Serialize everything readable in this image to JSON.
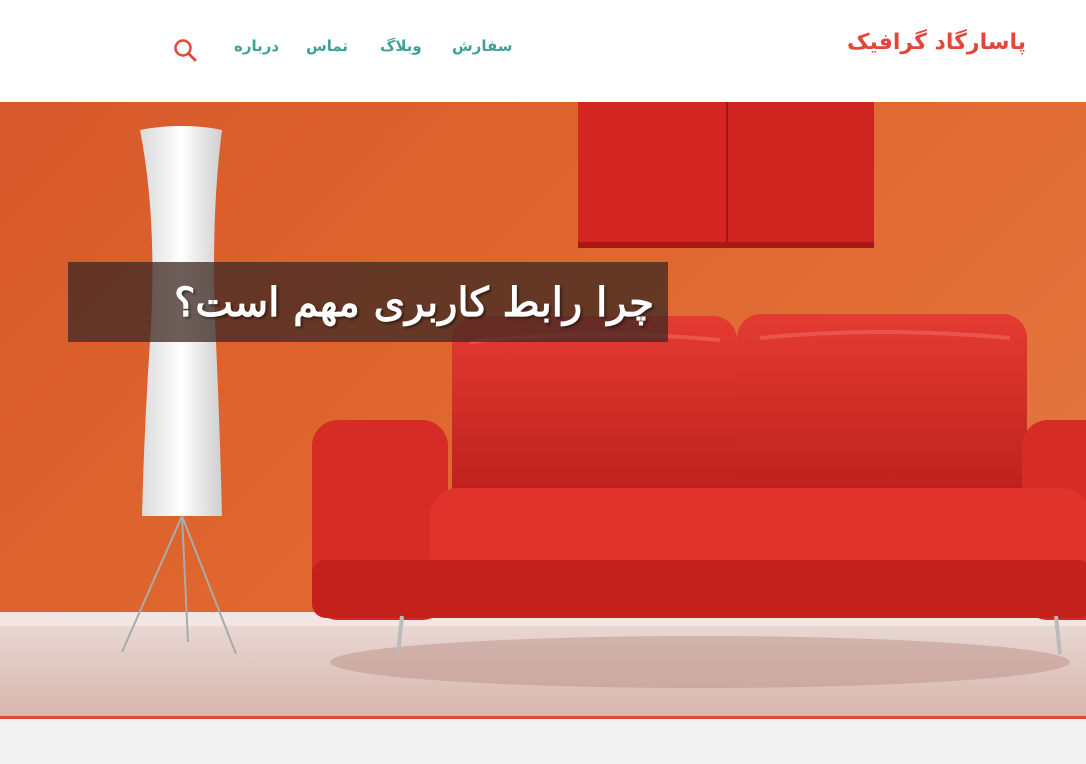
{
  "header": {
    "brand": "پاسارگاد گرافیک",
    "nav": [
      {
        "label": "سفارش"
      },
      {
        "label": "وبلاگ"
      },
      {
        "label": "تماس"
      },
      {
        "label": "درباره"
      }
    ],
    "search_icon": "search-icon"
  },
  "hero": {
    "title": "چرا رابط کاربری مهم است؟",
    "image": "red-sofa-living-room-photo"
  },
  "colors": {
    "brand": "#e2483a",
    "nav": "#3fa394",
    "hero_wall": "#e0672f",
    "accent_rule": "#e2483a"
  }
}
